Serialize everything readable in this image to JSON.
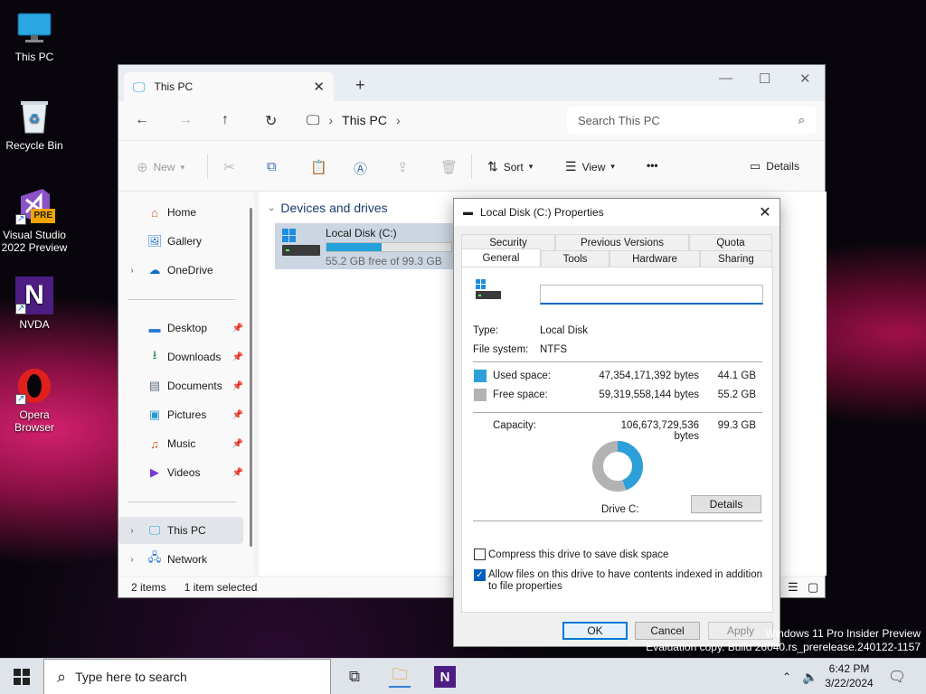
{
  "desktop": {
    "icons": [
      {
        "label": "This PC"
      },
      {
        "label": "Recycle Bin"
      },
      {
        "label": "Visual Studio 2022 Preview",
        "badge": "PRE"
      },
      {
        "label": "NVDA",
        "glyph": "N"
      },
      {
        "label": "Opera Browser"
      }
    ],
    "watermark": {
      "line1": "Windows 11 Pro Insider Preview",
      "line2": "Evaluation copy. Build 26040.rs_prerelease.240122-1157"
    }
  },
  "explorer": {
    "tab_title": "This PC",
    "breadcrumb": {
      "location": "This PC"
    },
    "search_placeholder": "Search This PC",
    "commands": {
      "new": "New",
      "sort": "Sort",
      "view": "View",
      "more": "•••",
      "details": "Details"
    },
    "sidebar": {
      "top": [
        {
          "label": "Home",
          "icon": "home-icon"
        },
        {
          "label": "Gallery",
          "icon": "gallery-icon"
        },
        {
          "label": "OneDrive",
          "icon": "cloud-icon"
        }
      ],
      "quick": [
        {
          "label": "Desktop",
          "icon": "desktop-icon"
        },
        {
          "label": "Downloads",
          "icon": "download-icon"
        },
        {
          "label": "Documents",
          "icon": "documents-icon"
        },
        {
          "label": "Pictures",
          "icon": "pictures-icon"
        },
        {
          "label": "Music",
          "icon": "music-icon"
        },
        {
          "label": "Videos",
          "icon": "videos-icon"
        }
      ],
      "bottom": [
        {
          "label": "This PC",
          "icon": "pc-icon"
        },
        {
          "label": "Network",
          "icon": "network-icon"
        }
      ]
    },
    "group_header": "Devices and drives",
    "drive": {
      "name": "Local Disk (C:)",
      "free_text": "55.2 GB free of 99.3 GB",
      "used_fraction": 0.444
    },
    "status": {
      "items": "2 items",
      "selected": "1 item selected"
    }
  },
  "dialog": {
    "title": "Local Disk (C:) Properties",
    "tabs_row1": [
      "Security",
      "Previous Versions",
      "Quota"
    ],
    "tabs_row2": [
      "General",
      "Tools",
      "Hardware",
      "Sharing"
    ],
    "name_value": "",
    "type_label": "Type:",
    "type_value": "Local Disk",
    "fs_label": "File system:",
    "fs_value": "NTFS",
    "used_label": "Used space:",
    "used_bytes": "47,354,171,392 bytes",
    "used_gb": "44.1 GB",
    "free_label": "Free space:",
    "free_bytes": "59,319,558,144 bytes",
    "free_gb": "55.2 GB",
    "cap_label": "Capacity:",
    "cap_bytes": "106,673,729,536 bytes",
    "cap_gb": "99.3 GB",
    "used_fraction": 0.444,
    "drive_label": "Drive C:",
    "details_button": "Details",
    "compress_label": "Compress this drive to save disk space",
    "compress_checked": false,
    "index_label": "Allow files on this drive to have contents indexed in addition to file properties",
    "index_checked": true,
    "ok": "OK",
    "cancel": "Cancel",
    "apply": "Apply",
    "colors": {
      "used": "#2d9fd9",
      "free": "#b3b3b3"
    }
  },
  "taskbar": {
    "search_placeholder": "Type here to search",
    "time": "6:42 PM",
    "date": "3/22/2024"
  }
}
